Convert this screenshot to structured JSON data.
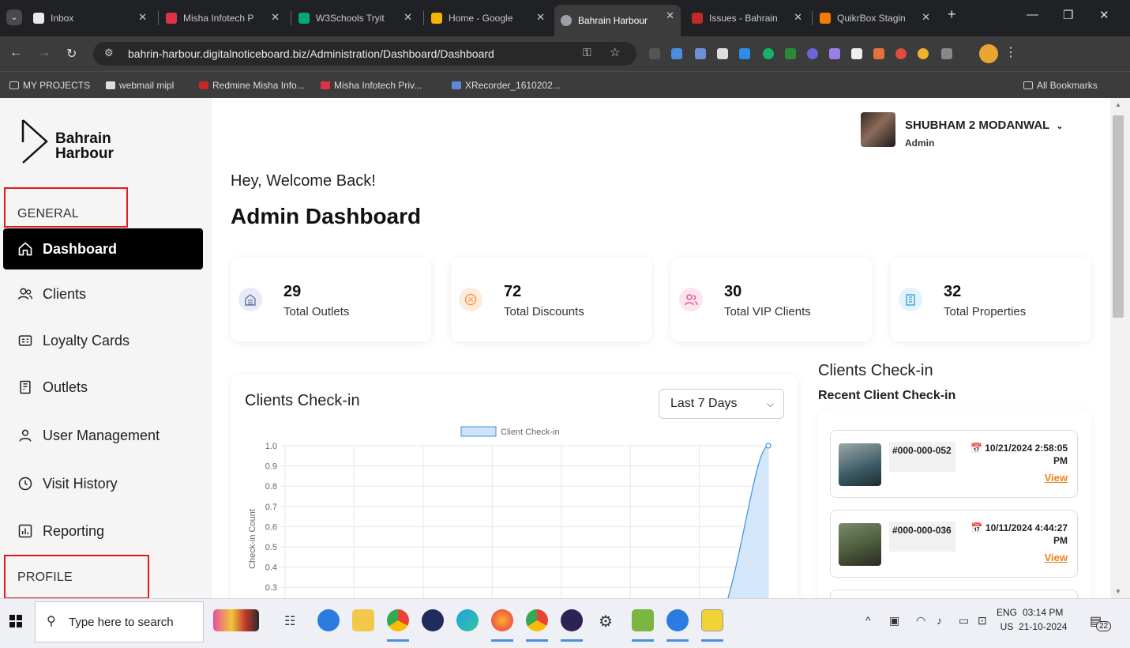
{
  "browser": {
    "tabs": [
      {
        "label": "Inbox",
        "color": "#e9e9e9"
      },
      {
        "label": "Misha Infotech P",
        "color": "#e0314b"
      },
      {
        "label": "W3Schools Tryit",
        "color": "#04aa6d"
      },
      {
        "label": "Home - Google",
        "color": "#f4b400"
      },
      {
        "label": "Bahrain Harbour",
        "color": "#9aa0a6"
      },
      {
        "label": "Issues - Bahrain",
        "color": "#c62828"
      },
      {
        "label": "QuikrBox Stagin",
        "color": "#f57c00"
      }
    ],
    "url": "bahrin-harbour.digitalnoticeboard.biz/Administration/Dashboard/Dashboard",
    "bookmarks": [
      {
        "label": "MY PROJECTS"
      },
      {
        "label": "webmail mipl"
      },
      {
        "label": "Redmine Misha Info..."
      },
      {
        "label": "Misha Infotech Priv..."
      },
      {
        "label": "XRecorder_1610202..."
      }
    ],
    "all_bookmarks": "All Bookmarks"
  },
  "sidebar": {
    "logo_line1": "Bahrain",
    "logo_line2": "Harbour",
    "general_label": "GENERAL",
    "items": [
      {
        "label": "Dashboard",
        "icon": "home-icon"
      },
      {
        "label": "Clients",
        "icon": "users-icon"
      },
      {
        "label": "Loyalty Cards",
        "icon": "card-icon"
      },
      {
        "label": "Outlets",
        "icon": "outlet-icon"
      },
      {
        "label": "User Management",
        "icon": "user-icon"
      },
      {
        "label": "Visit History",
        "icon": "clock-icon"
      },
      {
        "label": "Reporting",
        "icon": "chart-icon"
      }
    ],
    "profile_label": "PROFILE"
  },
  "header": {
    "user_name": "SHUBHAM 2 MODANWAL",
    "user_role": "Admin"
  },
  "main": {
    "welcome": "Hey, Welcome Back!",
    "title": "Admin Dashboard",
    "stats": [
      {
        "value": "29",
        "label": "Total Outlets",
        "color": "#e8ebf7",
        "icon": "building-icon"
      },
      {
        "value": "72",
        "label": "Total Discounts",
        "color": "#fdebdc",
        "icon": "discount-icon"
      },
      {
        "value": "30",
        "label": "Total VIP Clients",
        "color": "#fde4ef",
        "icon": "vip-icon"
      },
      {
        "value": "32",
        "label": "Total Properties",
        "color": "#e2f4fb",
        "icon": "property-icon"
      }
    ],
    "chart_title": "Clients Check-in",
    "range": "Last 7 Days"
  },
  "chart_data": {
    "type": "area",
    "series": [
      {
        "name": "Client Check-in",
        "values": [
          0,
          0,
          0,
          0,
          0,
          0,
          0,
          1
        ]
      }
    ],
    "ylabel": "Check-in Count",
    "ylim": [
      0,
      1
    ],
    "yticks": [
      "1.0",
      "0.9",
      "0.8",
      "0.7",
      "0.6",
      "0.5",
      "0.4",
      "0.3"
    ],
    "color": "#3a8fe0",
    "legend": "top"
  },
  "checkin": {
    "title": "Clients Check-in",
    "subtitle": "Recent Client Check-in",
    "items": [
      {
        "id": "#000-000-052",
        "date": "10/21/2024 2:58:05 PM",
        "view": "View",
        "color": "#3b5a64"
      },
      {
        "id": "#000-000-036",
        "date": "10/11/2024 4:44:27 PM",
        "view": "View",
        "color": "#4a5a3a"
      }
    ]
  },
  "taskbar": {
    "search_placeholder": "Type here to search",
    "lang_top": "ENG",
    "lang_bottom": "US",
    "time": "03:14 PM",
    "date": "21-10-2024",
    "notifications": "22"
  }
}
